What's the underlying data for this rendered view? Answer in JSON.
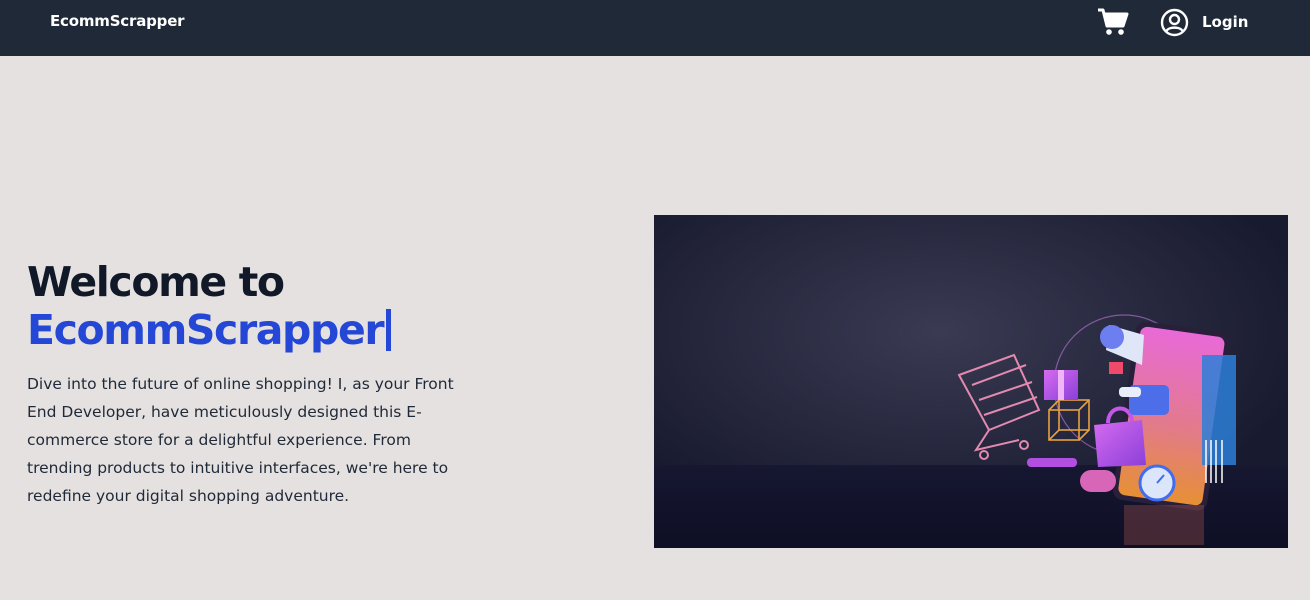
{
  "navbar": {
    "brand": "EcommScrapper",
    "cart_icon": "shopping-cart-icon",
    "user_icon": "user-circle-icon",
    "login_label": "Login"
  },
  "hero": {
    "title_line1": "Welcome to",
    "title_line2": "EcommScrapper",
    "description": "Dive into the future of online shopping! I, as your Front End Developer, have meticulously designed this E-commerce store for a delightful experience. From trending products to intuitive interfaces, we're here to redefine your digital shopping adventure.",
    "image_icon": "online-shopping-illustration"
  },
  "colors": {
    "navbar_bg": "#1f2937",
    "page_bg": "#e5e1e0",
    "accent_blue": "#2447d6",
    "heading_dark": "#111827"
  }
}
